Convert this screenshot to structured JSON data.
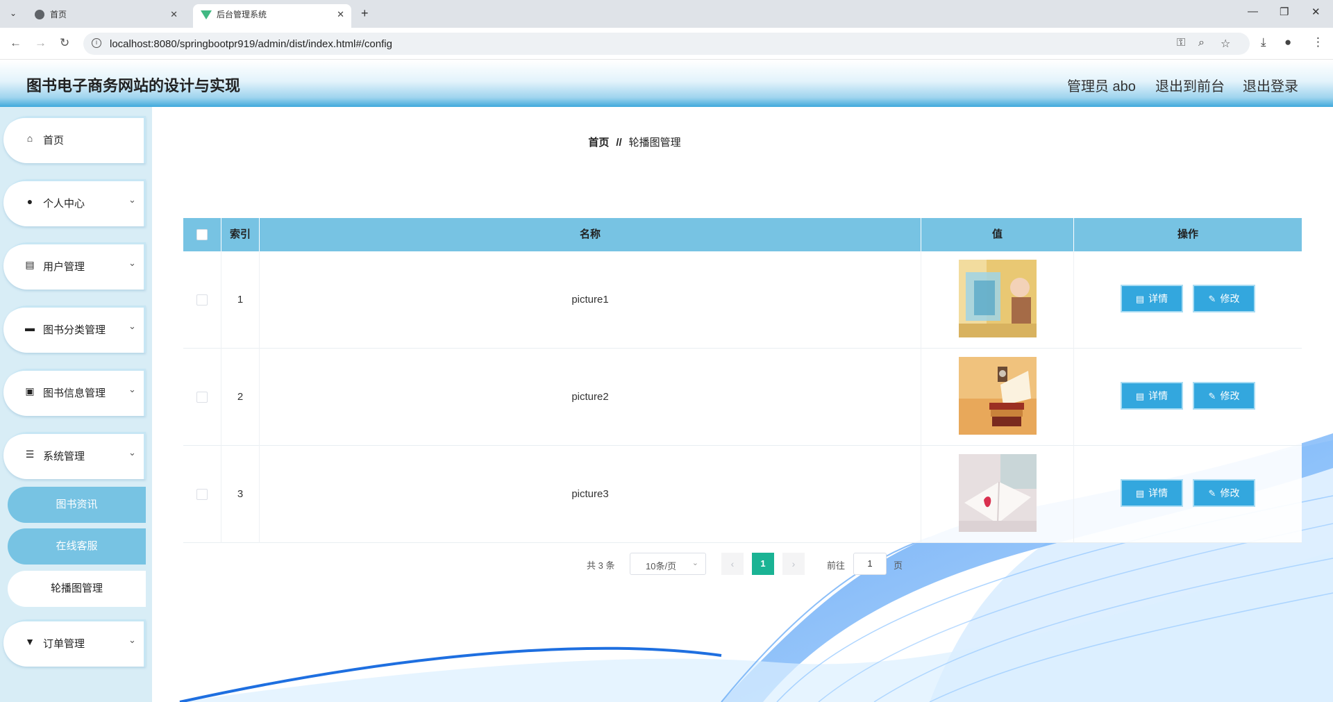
{
  "browser": {
    "tabs": [
      {
        "title": "首页",
        "active": false
      },
      {
        "title": "后台管理系统",
        "active": true
      }
    ],
    "url": "localhost:8080/springbootpr919/admin/dist/index.html#/config",
    "tab_close_glyph": "✕",
    "new_tab_glyph": "+"
  },
  "header": {
    "title": "图书电子商务网站的设计与实现",
    "user": "管理员 abo",
    "to_front": "退出到前台",
    "logout": "退出登录"
  },
  "sidebar": {
    "items": [
      {
        "label": "首页",
        "icon": "home-icon",
        "has_caret": false
      },
      {
        "label": "个人中心",
        "icon": "user-icon",
        "has_caret": true
      },
      {
        "label": "用户管理",
        "icon": "clipboard-icon",
        "has_caret": true
      },
      {
        "label": "图书分类管理",
        "icon": "chat-icon",
        "has_caret": true
      },
      {
        "label": "图书信息管理",
        "icon": "calendar-x-icon",
        "has_caret": true
      },
      {
        "label": "系统管理",
        "icon": "sliders-icon",
        "has_caret": true
      },
      {
        "label": "订单管理",
        "icon": "sign-icon",
        "has_caret": true
      }
    ],
    "sub_items": [
      {
        "label": "图书资讯"
      },
      {
        "label": "在线客服"
      },
      {
        "label": "轮播图管理"
      }
    ]
  },
  "breadcrumb": {
    "home": "首页",
    "sep": "//",
    "current": "轮播图管理"
  },
  "table": {
    "columns": [
      "索引",
      "名称",
      "值",
      "操作"
    ],
    "rows": [
      {
        "index": "1",
        "name": "picture1",
        "image": "picture1-thumbnail"
      },
      {
        "index": "2",
        "name": "picture2",
        "image": "picture2-thumbnail"
      },
      {
        "index": "3",
        "name": "picture3",
        "image": "picture3-thumbnail"
      }
    ],
    "detail_label": "详情",
    "edit_label": "修改"
  },
  "pagination": {
    "total": "共 3 条",
    "page_size": "10条/页",
    "current_page": "1",
    "goto_label": "前往",
    "goto_value": "1",
    "page_unit": "页"
  },
  "colors": {
    "accent": "#77c3e3",
    "button": "#33a7de",
    "active_page": "#1ab394",
    "sidebar_bg": "#d8edf6"
  }
}
